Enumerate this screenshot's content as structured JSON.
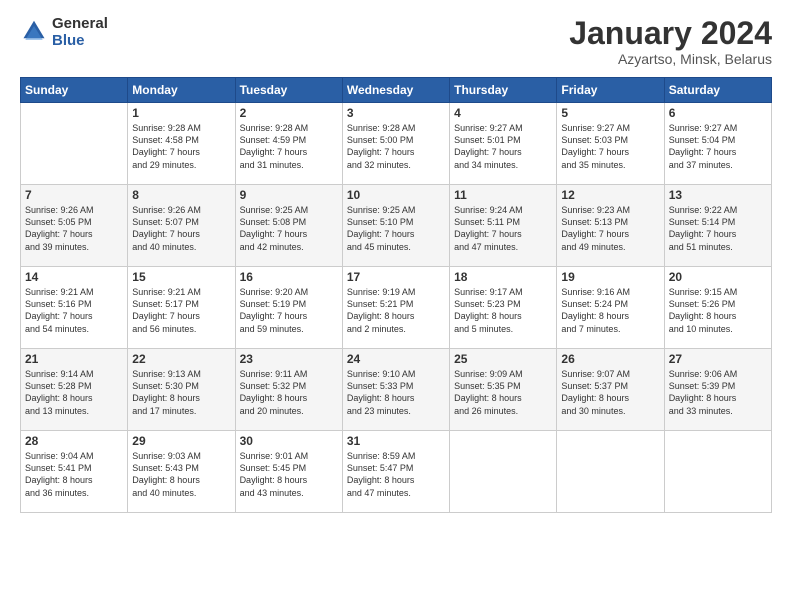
{
  "header": {
    "logo_general": "General",
    "logo_blue": "Blue",
    "month_title": "January 2024",
    "subtitle": "Azyartso, Minsk, Belarus"
  },
  "days_of_week": [
    "Sunday",
    "Monday",
    "Tuesday",
    "Wednesday",
    "Thursday",
    "Friday",
    "Saturday"
  ],
  "weeks": [
    [
      {
        "day": "",
        "info": ""
      },
      {
        "day": "1",
        "info": "Sunrise: 9:28 AM\nSunset: 4:58 PM\nDaylight: 7 hours\nand 29 minutes."
      },
      {
        "day": "2",
        "info": "Sunrise: 9:28 AM\nSunset: 4:59 PM\nDaylight: 7 hours\nand 31 minutes."
      },
      {
        "day": "3",
        "info": "Sunrise: 9:28 AM\nSunset: 5:00 PM\nDaylight: 7 hours\nand 32 minutes."
      },
      {
        "day": "4",
        "info": "Sunrise: 9:27 AM\nSunset: 5:01 PM\nDaylight: 7 hours\nand 34 minutes."
      },
      {
        "day": "5",
        "info": "Sunrise: 9:27 AM\nSunset: 5:03 PM\nDaylight: 7 hours\nand 35 minutes."
      },
      {
        "day": "6",
        "info": "Sunrise: 9:27 AM\nSunset: 5:04 PM\nDaylight: 7 hours\nand 37 minutes."
      }
    ],
    [
      {
        "day": "7",
        "info": "Sunrise: 9:26 AM\nSunset: 5:05 PM\nDaylight: 7 hours\nand 39 minutes."
      },
      {
        "day": "8",
        "info": "Sunrise: 9:26 AM\nSunset: 5:07 PM\nDaylight: 7 hours\nand 40 minutes."
      },
      {
        "day": "9",
        "info": "Sunrise: 9:25 AM\nSunset: 5:08 PM\nDaylight: 7 hours\nand 42 minutes."
      },
      {
        "day": "10",
        "info": "Sunrise: 9:25 AM\nSunset: 5:10 PM\nDaylight: 7 hours\nand 45 minutes."
      },
      {
        "day": "11",
        "info": "Sunrise: 9:24 AM\nSunset: 5:11 PM\nDaylight: 7 hours\nand 47 minutes."
      },
      {
        "day": "12",
        "info": "Sunrise: 9:23 AM\nSunset: 5:13 PM\nDaylight: 7 hours\nand 49 minutes."
      },
      {
        "day": "13",
        "info": "Sunrise: 9:22 AM\nSunset: 5:14 PM\nDaylight: 7 hours\nand 51 minutes."
      }
    ],
    [
      {
        "day": "14",
        "info": "Sunrise: 9:21 AM\nSunset: 5:16 PM\nDaylight: 7 hours\nand 54 minutes."
      },
      {
        "day": "15",
        "info": "Sunrise: 9:21 AM\nSunset: 5:17 PM\nDaylight: 7 hours\nand 56 minutes."
      },
      {
        "day": "16",
        "info": "Sunrise: 9:20 AM\nSunset: 5:19 PM\nDaylight: 7 hours\nand 59 minutes."
      },
      {
        "day": "17",
        "info": "Sunrise: 9:19 AM\nSunset: 5:21 PM\nDaylight: 8 hours\nand 2 minutes."
      },
      {
        "day": "18",
        "info": "Sunrise: 9:17 AM\nSunset: 5:23 PM\nDaylight: 8 hours\nand 5 minutes."
      },
      {
        "day": "19",
        "info": "Sunrise: 9:16 AM\nSunset: 5:24 PM\nDaylight: 8 hours\nand 7 minutes."
      },
      {
        "day": "20",
        "info": "Sunrise: 9:15 AM\nSunset: 5:26 PM\nDaylight: 8 hours\nand 10 minutes."
      }
    ],
    [
      {
        "day": "21",
        "info": "Sunrise: 9:14 AM\nSunset: 5:28 PM\nDaylight: 8 hours\nand 13 minutes."
      },
      {
        "day": "22",
        "info": "Sunrise: 9:13 AM\nSunset: 5:30 PM\nDaylight: 8 hours\nand 17 minutes."
      },
      {
        "day": "23",
        "info": "Sunrise: 9:11 AM\nSunset: 5:32 PM\nDaylight: 8 hours\nand 20 minutes."
      },
      {
        "day": "24",
        "info": "Sunrise: 9:10 AM\nSunset: 5:33 PM\nDaylight: 8 hours\nand 23 minutes."
      },
      {
        "day": "25",
        "info": "Sunrise: 9:09 AM\nSunset: 5:35 PM\nDaylight: 8 hours\nand 26 minutes."
      },
      {
        "day": "26",
        "info": "Sunrise: 9:07 AM\nSunset: 5:37 PM\nDaylight: 8 hours\nand 30 minutes."
      },
      {
        "day": "27",
        "info": "Sunrise: 9:06 AM\nSunset: 5:39 PM\nDaylight: 8 hours\nand 33 minutes."
      }
    ],
    [
      {
        "day": "28",
        "info": "Sunrise: 9:04 AM\nSunset: 5:41 PM\nDaylight: 8 hours\nand 36 minutes."
      },
      {
        "day": "29",
        "info": "Sunrise: 9:03 AM\nSunset: 5:43 PM\nDaylight: 8 hours\nand 40 minutes."
      },
      {
        "day": "30",
        "info": "Sunrise: 9:01 AM\nSunset: 5:45 PM\nDaylight: 8 hours\nand 43 minutes."
      },
      {
        "day": "31",
        "info": "Sunrise: 8:59 AM\nSunset: 5:47 PM\nDaylight: 8 hours\nand 47 minutes."
      },
      {
        "day": "",
        "info": ""
      },
      {
        "day": "",
        "info": ""
      },
      {
        "day": "",
        "info": ""
      }
    ]
  ]
}
